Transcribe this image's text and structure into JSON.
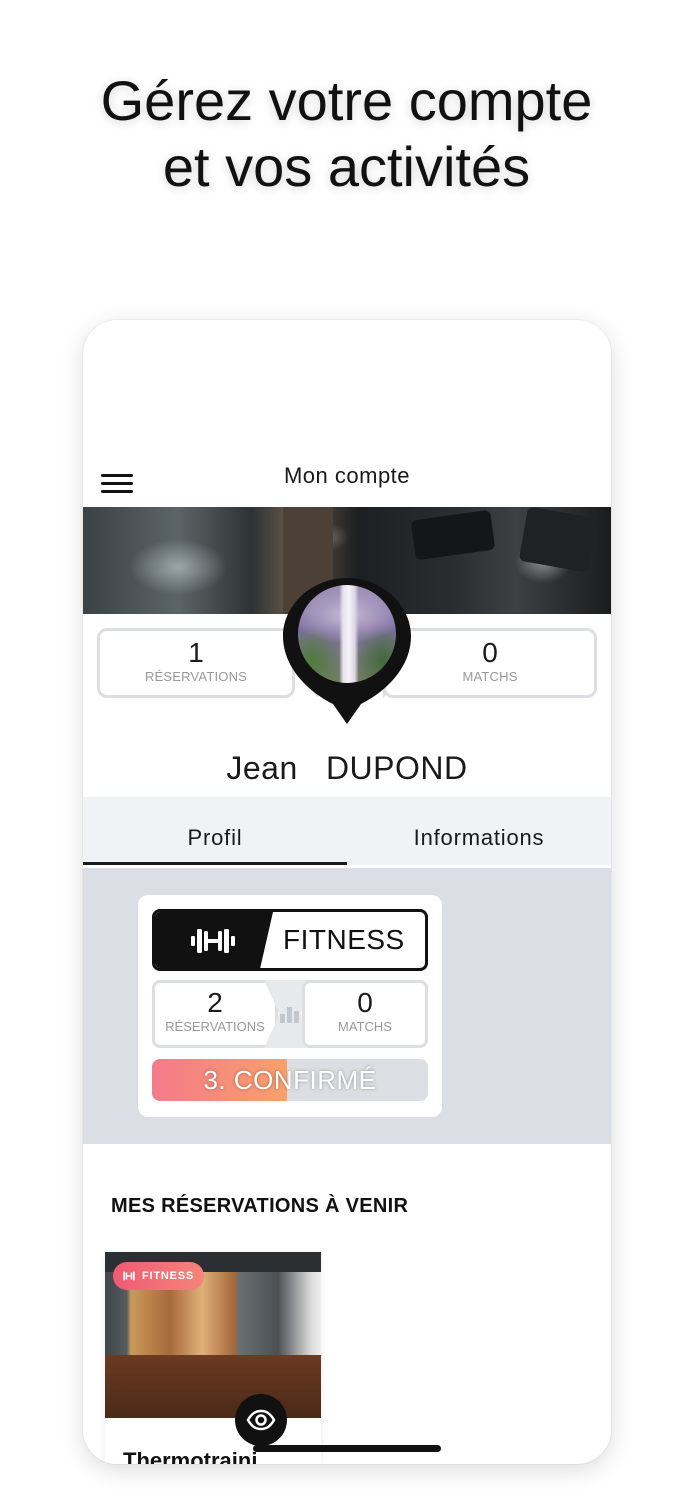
{
  "headline": {
    "line1": "Gérez votre compte",
    "line2": "et vos activités"
  },
  "app": {
    "title": "Mon compte",
    "stats": {
      "reservations_value": "1",
      "reservations_label": "RÉSERVATIONS",
      "matchs_value": "0",
      "matchs_label": "MATCHS"
    },
    "user": {
      "first_name": "Jean",
      "last_name": "DUPOND"
    },
    "tabs": [
      {
        "label": "Profil",
        "active": true
      },
      {
        "label": "Informations",
        "active": false
      }
    ],
    "sport_card": {
      "sport": "FITNESS",
      "icon": "dumbbell-icon",
      "reservations_value": "2",
      "reservations_label": "RÉSERVATIONS",
      "matchs_value": "0",
      "matchs_label": "MATCHS",
      "rank_label": "3. CONFIRMÉ",
      "rank_progress": 0.49
    },
    "upcoming": {
      "title": "MES RÉSERVATIONS À VENIR",
      "items": [
        {
          "badge": "FITNESS",
          "name": "Thermotraini"
        }
      ]
    }
  },
  "colors": {
    "accent_gradient_start": "#f47a8a",
    "accent_gradient_end": "#f7a06a",
    "dark": "#111111",
    "panel_gray": "#dcdee5"
  }
}
